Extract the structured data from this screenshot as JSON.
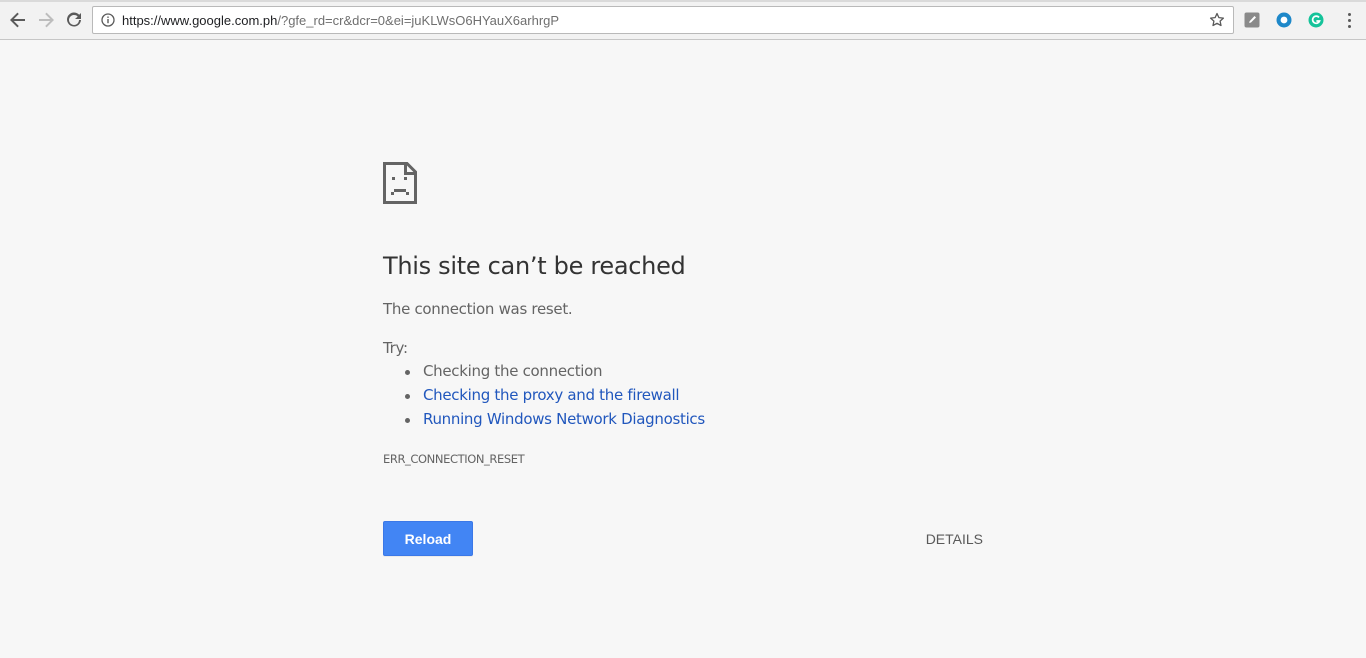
{
  "browser": {
    "url_host": "https://www.google.com.ph",
    "url_rest": "/?gfe_rd=cr&dcr=0&ei=juKLWsO6HYauX6arhrgP",
    "icons": {
      "back": "back-arrow-icon",
      "forward": "forward-arrow-icon",
      "reload": "reload-icon",
      "info": "info-icon",
      "star": "star-icon",
      "ext1": "extension-icon",
      "ext2": "circle-extension-icon",
      "ext3": "grammarly-icon",
      "menu": "menu-dots-icon"
    }
  },
  "error_page": {
    "title": "This site can’t be reached",
    "subtitle": "The connection was reset.",
    "try_label": "Try:",
    "suggestions": [
      {
        "text": "Checking the connection",
        "is_link": false
      },
      {
        "text": "Checking the proxy and the firewall",
        "is_link": true
      },
      {
        "text": "Running Windows Network Diagnostics",
        "is_link": true
      }
    ],
    "error_code": "ERR_CONNECTION_RESET",
    "reload_label": "Reload",
    "details_label": "DETAILS"
  },
  "colors": {
    "background": "#f7f7f7",
    "link": "#2157bd",
    "button": "#4285f4",
    "text": "#646464",
    "title": "#333333"
  }
}
